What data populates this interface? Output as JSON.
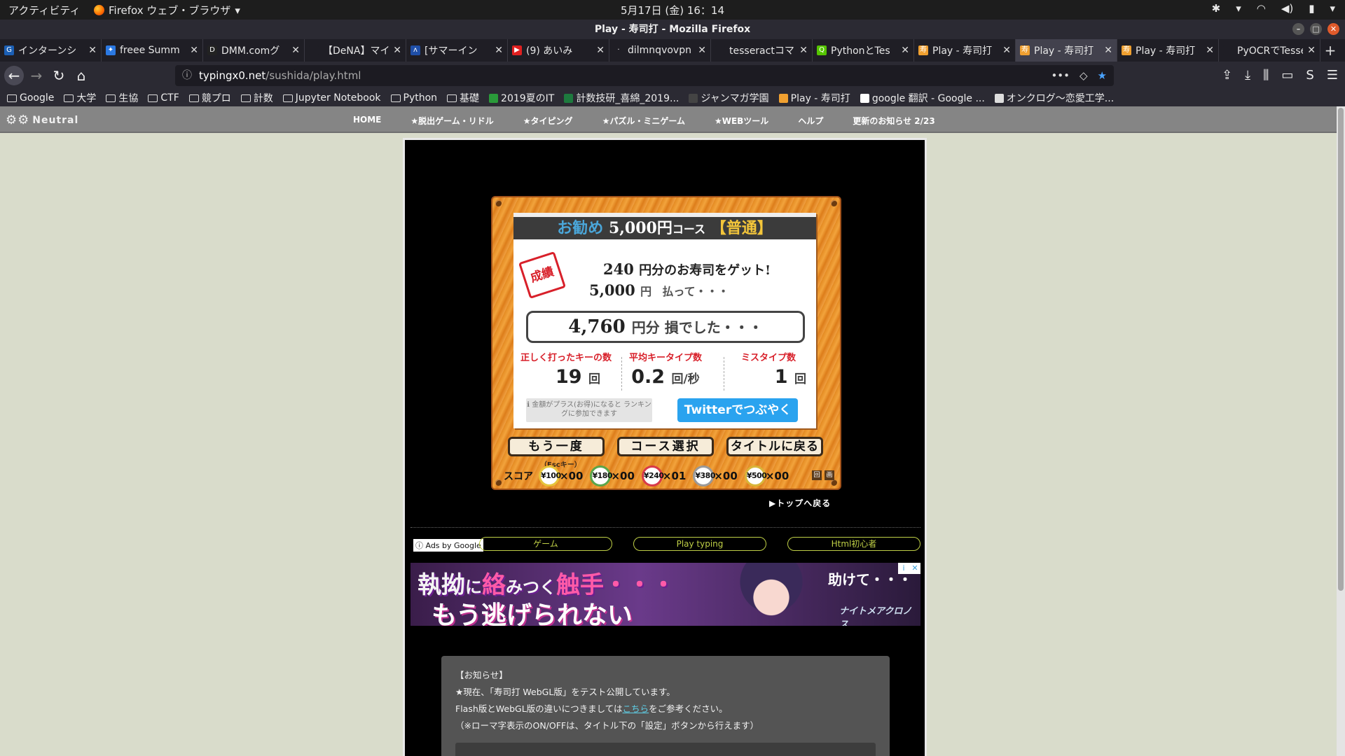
{
  "os_bar": {
    "activities": "アクティビティ",
    "app_name": "Firefox ウェブ・ブラウザ",
    "app_menu_arrow": "▾",
    "clock": "5月17日 (金) 16：14",
    "tray_icons": [
      "slack-icon",
      "dropdown-icon",
      "wifi-icon",
      "volume-icon",
      "battery-icon",
      "power-menu-icon"
    ]
  },
  "window": {
    "title": "Play - 寿司打 - Mozilla Firefox",
    "buttons": [
      "minimize",
      "maximize",
      "close"
    ]
  },
  "tabs": [
    {
      "title": "インターンシ",
      "icon_color": "#1b5fb5",
      "icon_glyph": "G"
    },
    {
      "title": "freee Summ",
      "icon_color": "#2b79e3",
      "icon_glyph": "✦"
    },
    {
      "title": "DMM.comグ",
      "icon_color": "#222222",
      "icon_glyph": "D"
    },
    {
      "title": "【DeNA】マイ",
      "icon_color": "#1f1e25",
      "icon_glyph": ""
    },
    {
      "title": "[サマーイン",
      "icon_color": "#1f4fa8",
      "icon_glyph": "ʌ"
    },
    {
      "title": "(9) あいみ",
      "icon_color": "#e02020",
      "icon_glyph": "▶"
    },
    {
      "title": "dilmnqvovpn",
      "icon_color": "#1f1e25",
      "icon_glyph": "·"
    },
    {
      "title": "tesseractコマン",
      "icon_color": "#1f1e25",
      "icon_glyph": ""
    },
    {
      "title": "PythonとTes",
      "icon_color": "#55c500",
      "icon_glyph": "Q"
    },
    {
      "title": "Play - 寿司打",
      "icon_color": "#f0a030",
      "icon_glyph": "寿"
    },
    {
      "title": "Play - 寿司打",
      "icon_color": "#f0a030",
      "icon_glyph": "寿",
      "active": true
    },
    {
      "title": "Play - 寿司打",
      "icon_color": "#f0a030",
      "icon_glyph": "寿"
    },
    {
      "title": "PyOCRでTesser",
      "icon_color": "#1f1e25",
      "icon_glyph": ""
    }
  ],
  "tab_close": "✕",
  "new_tab": "+",
  "nav": {
    "back": "←",
    "forward": "→",
    "reload": "↻",
    "home": "⌂",
    "info_icon": "ⓘ",
    "url_host": "typingx0.net",
    "url_path": "/sushida/play.html",
    "page_actions": "•••",
    "pocket": "◇",
    "bookmark_star": "★",
    "right_tools": [
      "⇪",
      "⤓",
      "⫼",
      "▭",
      "S",
      "☰"
    ]
  },
  "bookmarks": [
    {
      "label": "Google",
      "icon": "folder"
    },
    {
      "label": "大学",
      "icon": "folder"
    },
    {
      "label": "生協",
      "icon": "folder"
    },
    {
      "label": "CTF",
      "icon": "folder"
    },
    {
      "label": "競プロ",
      "icon": "folder"
    },
    {
      "label": "計数",
      "icon": "folder"
    },
    {
      "label": "Jupyter Notebook",
      "icon": "folder"
    },
    {
      "label": "Python",
      "icon": "folder"
    },
    {
      "label": "基礎",
      "icon": "folder"
    },
    {
      "label": "2019夏のIT",
      "icon": "green-plus"
    },
    {
      "label": "計数技研_喜綿_2019...",
      "icon": "excel"
    },
    {
      "label": "ジャンマガ学園",
      "icon": "dark"
    },
    {
      "label": "Play - 寿司打",
      "icon": "sushi"
    },
    {
      "label": "google 翻訳 - Google ...",
      "icon": "google"
    },
    {
      "label": "オンクログ〜恋愛工学...",
      "icon": "page"
    }
  ],
  "site": {
    "logo": "Neutral",
    "logo_icon": "⚙⚙",
    "menu": [
      "HOME",
      "★脱出ゲーム・リドル",
      "★タイピング",
      "★パズル・ミニゲーム",
      "★WEBツール",
      "ヘルプ",
      "更新のお知らせ 2/23"
    ]
  },
  "result": {
    "course_label": "お勧め",
    "course_price": "5,000円",
    "course_suffix": "コース",
    "level": "【普通】",
    "stamp": "成績",
    "got_amount": "240",
    "got_text": "円分のお寿司をゲット!",
    "paid_amount": "5,000",
    "paid_unit": "円",
    "paid_text": "払って・・・",
    "loss_amount": "4,760",
    "loss_text": "円分 損でした・・・",
    "stats": [
      {
        "label": "正しく打ったキーの数",
        "value": "19",
        "unit": "回"
      },
      {
        "label": "平均キータイプ数",
        "value": "0.2",
        "unit": "回/秒"
      },
      {
        "label": "ミスタイプ数",
        "value": "1",
        "unit": "回"
      }
    ],
    "ranking_note_icon": "ℹ",
    "ranking_note": "金額がプラス(お得)になると ランキングに参加できます",
    "tweet_button": "Twitterでつぶやく",
    "buttons": {
      "retry": "もう一度",
      "course_select": "コース選択",
      "back_title": "タイトルに戻る"
    },
    "esc_hint": "（Escキー）",
    "score_label": "スコア",
    "plates": [
      {
        "price": "¥100",
        "count": "×00",
        "color": "#e6c43a"
      },
      {
        "price": "¥180",
        "count": "×00",
        "color": "#5aa64a"
      },
      {
        "price": "¥240",
        "count": "×01",
        "color": "#d83a4a"
      },
      {
        "price": "¥380",
        "count": "×00",
        "color": "#9a9a9a"
      },
      {
        "price": "¥500",
        "count": "×00",
        "color": "#d8b63a"
      }
    ],
    "mini_icons": [
      "回",
      "画"
    ]
  },
  "back_to_top": "▶トップへ戻る",
  "ads": {
    "ads_by": "ⓘ Ads by Google",
    "links": [
      "ゲーム",
      "Play typing",
      "Html初心者"
    ],
    "banner_line1_a": "執拗",
    "banner_line1_b": "に",
    "banner_line1_c": "絡",
    "banner_line1_d": "みつく",
    "banner_line1_e": "触手・・・",
    "banner_line2": "もう逃げられない",
    "banner_cry": "助けて・・・",
    "banner_brand": "ナイトメアクロノス",
    "adchoices": [
      "i",
      "✕"
    ]
  },
  "notice": {
    "heading": "【お知らせ】",
    "line1": "★現在、「寿司打 WebGL版」をテスト公開しています。",
    "line2_a": "Flash版とWebGL版の違いにつきましては",
    "line2_link": "こちら",
    "line2_b": "をご参考ください。",
    "line3": "（※ローマ字表示のON/OFFは、タイトル下の「設定」ボタンから行えます）"
  }
}
